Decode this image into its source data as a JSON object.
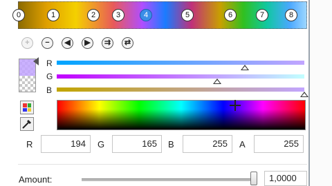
{
  "gradient": {
    "stops": [
      {
        "label": "0",
        "active": false
      },
      {
        "label": "1",
        "active": false
      },
      {
        "label": "2",
        "active": false
      },
      {
        "label": "3",
        "active": false
      },
      {
        "label": "4",
        "active": true
      },
      {
        "label": "5",
        "active": false
      },
      {
        "label": "6",
        "active": false
      },
      {
        "label": "7",
        "active": false
      },
      {
        "label": "8",
        "active": false
      }
    ]
  },
  "toolbar": {
    "buttons": [
      {
        "icon": "add-stop-icon",
        "glyph": "+",
        "enabled": false
      },
      {
        "icon": "remove-stop-icon",
        "glyph": "−",
        "enabled": true
      },
      {
        "icon": "move-left-icon",
        "glyph": "◀",
        "enabled": true
      },
      {
        "icon": "move-right-icon",
        "glyph": "▶",
        "enabled": true
      },
      {
        "icon": "distribute-icon",
        "glyph": "⇉",
        "enabled": true
      },
      {
        "icon": "reverse-icon",
        "glyph": "⇄",
        "enabled": true
      }
    ]
  },
  "sliders": {
    "r_label": "R",
    "g_label": "G",
    "b_label": "B",
    "r_value": 194,
    "g_value": 165,
    "b_value": 255
  },
  "fields": {
    "r_label": "R",
    "r_value": "194",
    "g_label": "G",
    "g_value": "165",
    "b_label": "B",
    "b_value": "255",
    "a_label": "A",
    "a_value": "255"
  },
  "amount": {
    "label": "Amount:",
    "value": "1,0000",
    "level": 1.0
  },
  "colors": {
    "current": "#c2a5ff",
    "active_stop": "#3b8ee8"
  }
}
